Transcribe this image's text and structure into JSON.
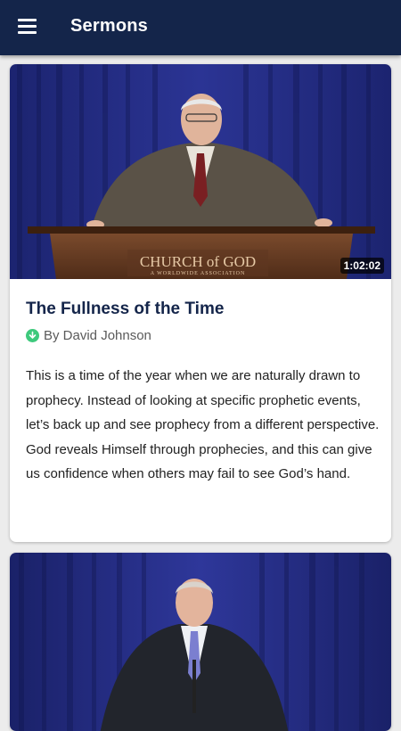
{
  "appbar": {
    "title": "Sermons",
    "menu_icon": "hamburger-menu-icon"
  },
  "colors": {
    "appbar": "#14254a",
    "title": "#14254a",
    "download_badge": "#3ec97c"
  },
  "sermons": [
    {
      "duration": "1:02:02",
      "title": "The Fullness of the Time",
      "author": "By David Johnson",
      "status_icon": "downloaded-check-icon",
      "description": "This is a time of the year when we are naturally drawn to prophecy. Instead of looking at specific prophetic events, let’s back up and see prophecy from a different perspective. God reveals Himself through prophecies, and this can give us confidence when others may fail to see God’s hand.",
      "podium_text": "CHURCH of GOD",
      "podium_subtext": "A WORLDWIDE ASSOCIATION"
    },
    {
      "duration": "",
      "title": "",
      "author": "",
      "description": ""
    }
  ]
}
